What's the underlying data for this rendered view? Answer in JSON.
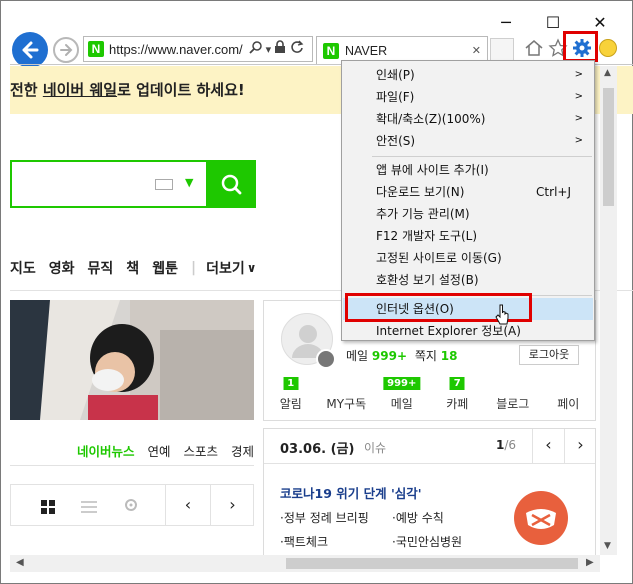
{
  "window": {
    "minimize": "─",
    "maximize": "☐",
    "close": "✕"
  },
  "address": {
    "url": "https://www.naver.com/",
    "logo": "N"
  },
  "tab": {
    "title": "NAVER",
    "logo": "N",
    "close": "✕"
  },
  "banner": {
    "text_prefix": "전한 ",
    "link": "네이버 웨일",
    "text_suffix": "로 업데이트 하세요!"
  },
  "nav": {
    "items": [
      "지도",
      "영화",
      "뮤직",
      "책",
      "웹툰",
      "더보기"
    ],
    "more_arrow": "∨"
  },
  "login": {
    "mail_label": "메일",
    "mail_count": "999+",
    "note_label": "쪽지",
    "note_count": "18",
    "logout": "로그아웃",
    "tabs": [
      {
        "label": "알림",
        "badge": "1"
      },
      {
        "label": "MY구독",
        "badge": ""
      },
      {
        "label": "메일",
        "badge": "999+"
      },
      {
        "label": "카페",
        "badge": "7"
      },
      {
        "label": "블로그",
        "badge": ""
      },
      {
        "label": "페이",
        "badge": ""
      }
    ]
  },
  "news_tabs": [
    "네이버뉴스",
    "연예",
    "스포츠",
    "경제"
  ],
  "issue": {
    "date": "03.06. (금)",
    "tag": "이슈",
    "page_current": "1",
    "page_total": "/6",
    "headline": "코로나19 위기 단계 '심각'",
    "links": [
      "정부 정례 브리핑",
      "예방 수칙",
      "팩트체크",
      "국민안심병원"
    ]
  },
  "menu": {
    "items": [
      {
        "label": "인쇄(P)",
        "shortcut": "",
        "submenu": true
      },
      {
        "label": "파일(F)",
        "shortcut": "",
        "submenu": true
      },
      {
        "label": "확대/축소(Z)(100%)",
        "shortcut": "",
        "submenu": true
      },
      {
        "label": "안전(S)",
        "shortcut": "",
        "submenu": true
      },
      {
        "label": "앱 뷰에 사이트 추가(I)",
        "shortcut": "",
        "submenu": false
      },
      {
        "label": "다운로드 보기(N)",
        "shortcut": "Ctrl+J",
        "submenu": false
      },
      {
        "label": "추가 기능 관리(M)",
        "shortcut": "",
        "submenu": false
      },
      {
        "label": "F12 개발자 도구(L)",
        "shortcut": "",
        "submenu": false
      },
      {
        "label": "고정된 사이트로 이동(G)",
        "shortcut": "",
        "submenu": false
      },
      {
        "label": "호환성 보기 설정(B)",
        "shortcut": "",
        "submenu": false
      },
      {
        "label": "인터넷 옵션(O)",
        "shortcut": "",
        "submenu": false
      },
      {
        "label": "Internet Explorer 정보(A)",
        "shortcut": "",
        "submenu": false
      }
    ],
    "submenu_arrow": ">"
  },
  "colors": {
    "naver_green": "#1ec800",
    "highlight_red": "#e00000",
    "menu_highlight": "#cce4f7"
  }
}
